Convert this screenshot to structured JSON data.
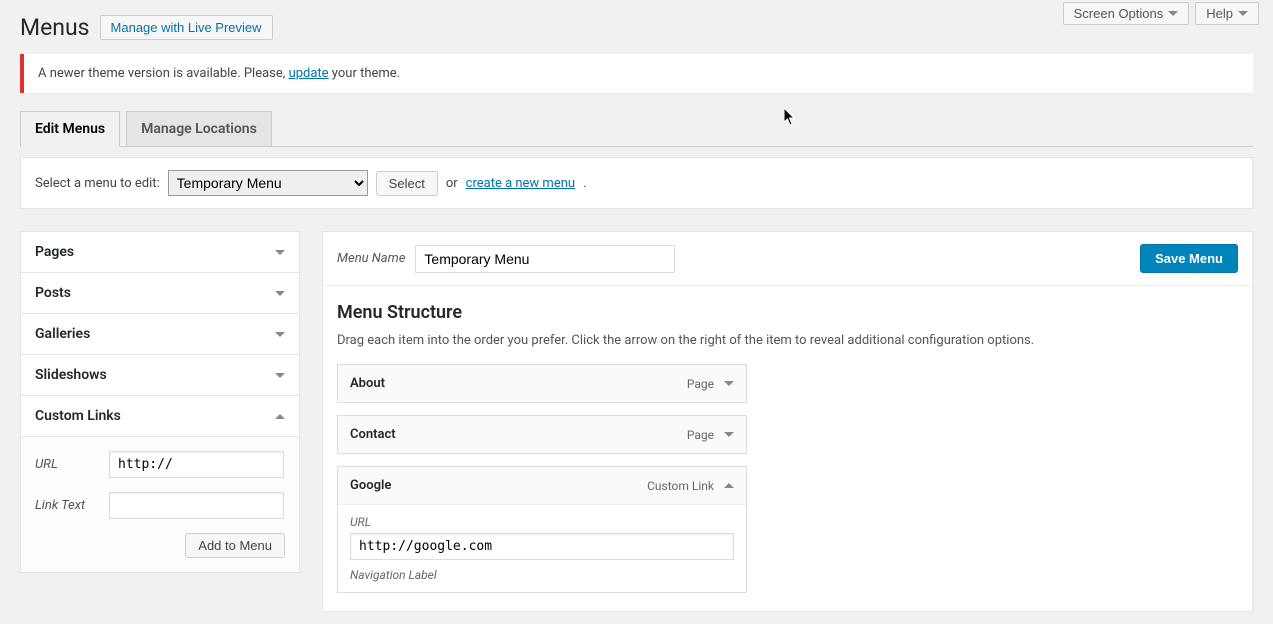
{
  "topActions": {
    "screenOptions": "Screen Options",
    "help": "Help"
  },
  "title": "Menus",
  "livePreview": "Manage with Live Preview",
  "notice": {
    "prefix": "A newer theme version is available. Please, ",
    "link": "update",
    "suffix": " your theme."
  },
  "tabs": {
    "edit": "Edit Menus",
    "manage": "Manage Locations"
  },
  "selectRow": {
    "label": "Select a menu to edit:",
    "selected": "Temporary Menu",
    "selectBtn": "Select",
    "or": "or",
    "createLink": "create a new menu",
    "period": "."
  },
  "accordion": {
    "pages": "Pages",
    "posts": "Posts",
    "galleries": "Galleries",
    "slideshows": "Slideshows",
    "custom": "Custom Links",
    "urlLabel": "URL",
    "urlValue": "http://",
    "linkTextLabel": "Link Text",
    "addBtn": "Add to Menu"
  },
  "menuHeader": {
    "nameLabel": "Menu Name",
    "nameValue": "Temporary Menu",
    "saveBtn": "Save Menu"
  },
  "structure": {
    "heading": "Menu Structure",
    "desc": "Drag each item into the order you prefer. Click the arrow on the right of the item to reveal additional configuration options.",
    "items": [
      {
        "title": "About",
        "type": "Page",
        "expanded": false
      },
      {
        "title": "Contact",
        "type": "Page",
        "expanded": false
      },
      {
        "title": "Google",
        "type": "Custom Link",
        "expanded": true,
        "urlLabel": "URL",
        "url": "http://google.com",
        "navLabel": "Navigation Label"
      }
    ]
  }
}
